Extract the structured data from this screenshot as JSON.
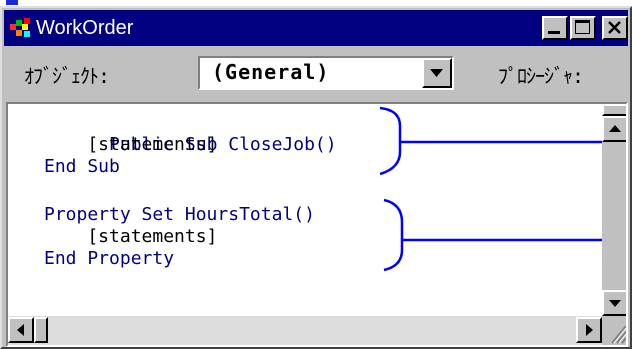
{
  "window": {
    "title": "WorkOrder",
    "titlebar_color": "#000080",
    "icon": "vb-module-icon",
    "controls": [
      "minimize-icon",
      "maximize-icon",
      "close-icon"
    ]
  },
  "toolbar": {
    "object_label": "ｵﾌﾞｼﾞｪｸﾄ:",
    "object_value": "(General)",
    "procedure_label": "ﾌﾟﾛｼｰｼﾞｬ:"
  },
  "code": {
    "keyword_color": "#000080",
    "lines": [
      "Public Sub CloseJob()",
      "    [statements]",
      "End Sub",
      "Property Set HoursTotal()",
      "    [statements]",
      "End Property"
    ]
  },
  "annotations": {
    "color": "#0000ff",
    "items": [
      "bracket-sub",
      "bracket-property"
    ]
  }
}
